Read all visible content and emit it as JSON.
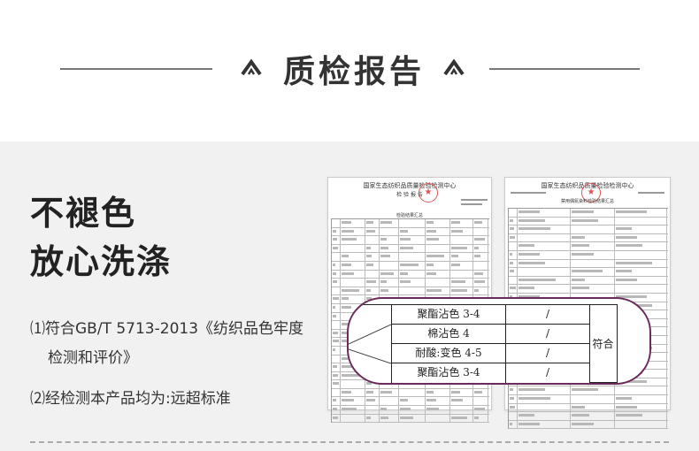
{
  "header": {
    "title": "质检报告"
  },
  "slogan": {
    "line1": "不褪色",
    "line2": "放心洗涤"
  },
  "points": {
    "p1_line1": "⑴符合GB/T 5713-2013《纺织品色牢度",
    "p1_line2": "检测和评价》",
    "p2": "⑵经检测本产品均为:远超标准"
  },
  "report1": {
    "org": "国家生态纺织品质量检验检测中心",
    "heading": "检 验 报 告",
    "table_title": "检验结果汇总"
  },
  "report2": {
    "org": "国家生态纺织品质量检验检测中心",
    "heading": "禁用偶氮染料检验结果汇总"
  },
  "overlay": {
    "rows": [
      {
        "item": "聚酯沾色 3-4",
        "value": "/"
      },
      {
        "item": "棉沾色 4",
        "value": "/"
      },
      {
        "item": "耐酸:变色 4-5",
        "value": "/"
      },
      {
        "item": "聚酯沾色 3-4",
        "value": "/"
      }
    ],
    "result": "符合"
  },
  "colors": {
    "accent": "#6a2a5a",
    "stamp": "#dd5555"
  }
}
